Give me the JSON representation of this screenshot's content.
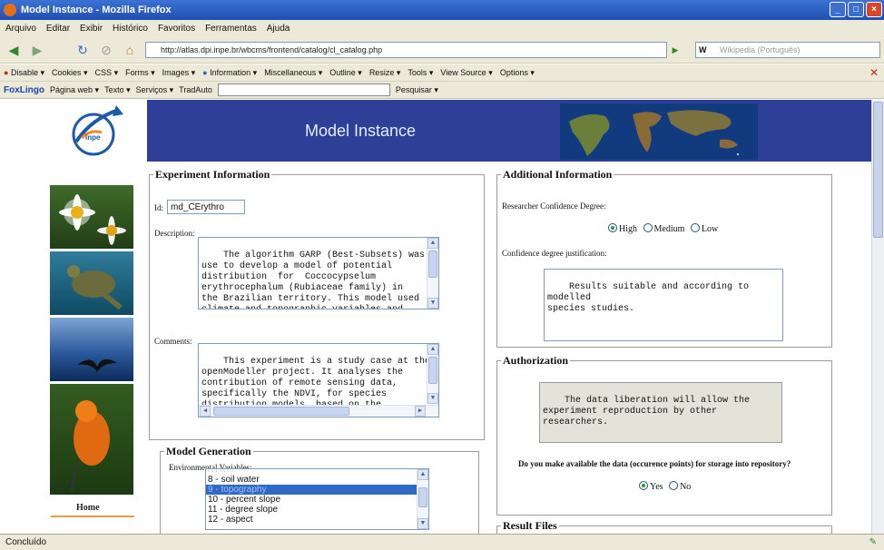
{
  "window": {
    "title": "Model Instance - Mozilla Firefox"
  },
  "menu": [
    "Arquivo",
    "Editar",
    "Exibir",
    "Histórico",
    "Favoritos",
    "Ferramentas",
    "Ajuda"
  ],
  "nav": {
    "url": "http://atlas.dpi.inpe.br/wbcms/frontend/catalog/cl_catalog.php",
    "search_placeholder": "Wikipedia (Português)",
    "search_engine": "W"
  },
  "devbar": [
    "Disable",
    "Cookies",
    "CSS",
    "Forms",
    "Images",
    "Information",
    "Miscellaneous",
    "Outline",
    "Resize",
    "Tools",
    "View Source",
    "Options"
  ],
  "foxbar": {
    "brand": "FoxLingo",
    "items": [
      "Página web",
      "Texto",
      "Serviços",
      "TradAuto"
    ],
    "search": "Pesquisar"
  },
  "status": "Concluído",
  "page": {
    "banner_title": "Model Instance",
    "home": "Home",
    "experiment": {
      "legend": "Experiment Information",
      "id_label": "Id:",
      "id_value": "md_CErythro",
      "description_label": "Description:",
      "description": "The algorithm GARP (Best-Subsets) was\nuse to develop a model of potential\ndistribution  for  Coccocypselum\nerythrocephalum (Rubiaceae family) in\nthe Brazilian territory. This model used\nclimate and topographic variables and",
      "comments_label": "Comments:",
      "comments": "This experiment is a study case at the\nopenModeller project. It analyses the\ncontribution of remote sensing data,\nspecifically the NDVI, for species\ndistribution models, based on the"
    },
    "generation": {
      "legend": "Model Generation",
      "env_label": "Environmental Variables:",
      "options": [
        "8 - soil water",
        "9 - topography",
        "10 - percent slope",
        "11 - degree slope",
        "12 - aspect"
      ],
      "selected": "9 - topography"
    },
    "additional": {
      "legend": "Additional Information",
      "confidence_label": "Researcher Confidence Degree:",
      "levels": [
        "High",
        "Medium",
        "Low"
      ],
      "selected": "High",
      "justification_label": "Confidence degree justification:",
      "justification": "Results suitable and according to modelled\nspecies studies."
    },
    "authorization": {
      "legend": "Authorization",
      "text": "The data liberation will allow the\nexperiment reproduction by other\nresearchers.",
      "question": "Do you make available the data (occurence points) for storage into repository?",
      "options": [
        "Yes",
        "No"
      ],
      "selected": "Yes"
    },
    "result": {
      "legend": "Result Files"
    }
  },
  "colors": {
    "banner": "#2d3f97",
    "titlebar": "#245edb",
    "chrome": "#ece9d8",
    "selection": "#316ac5"
  }
}
